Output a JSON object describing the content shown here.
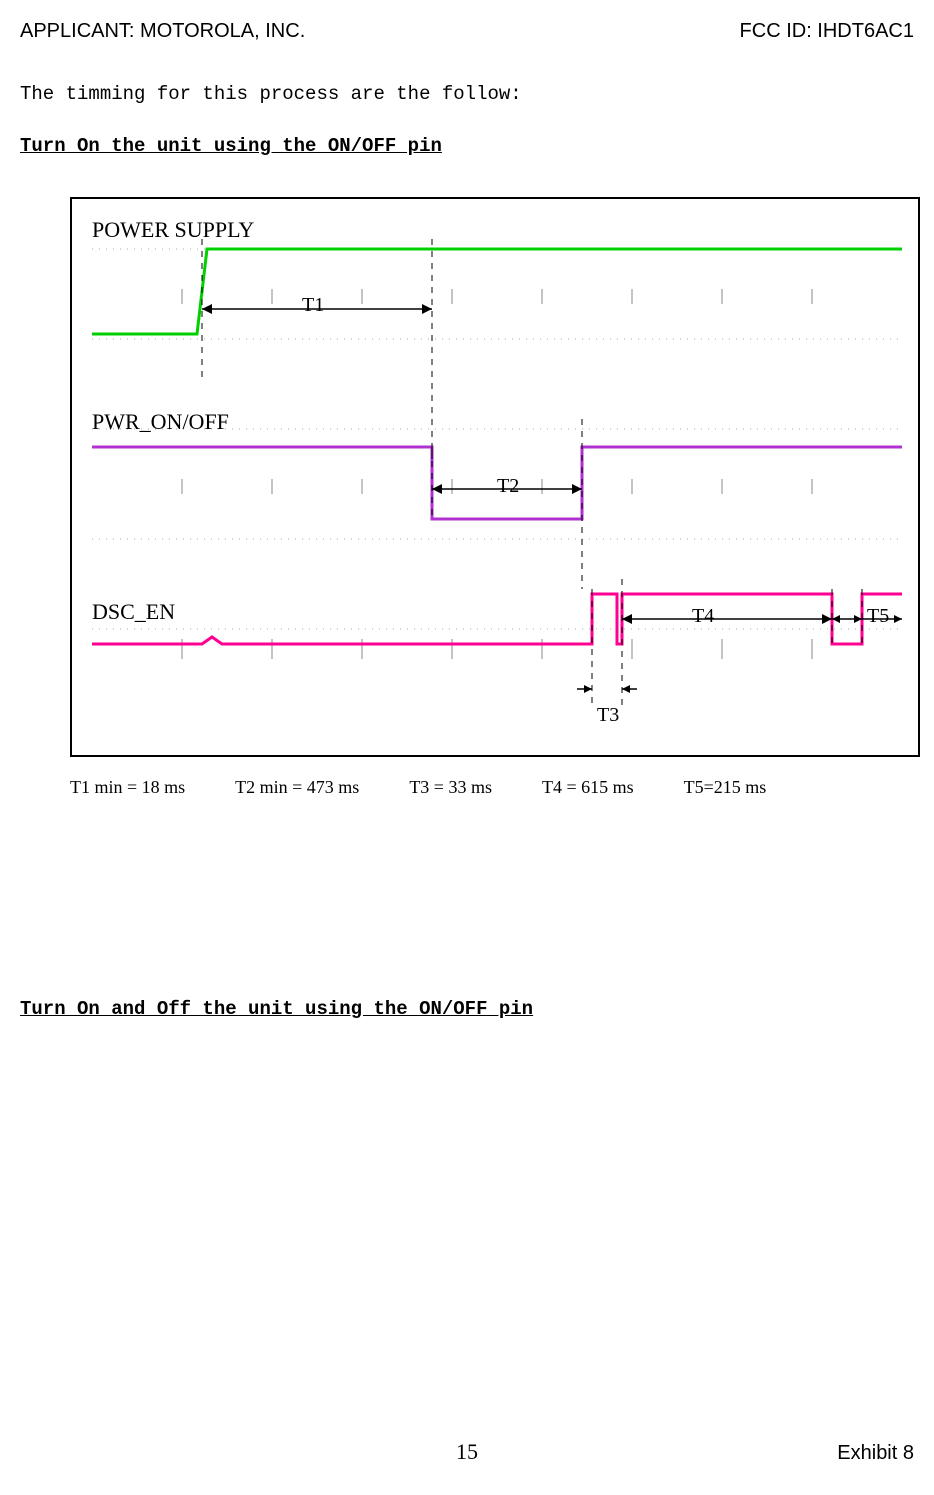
{
  "header": {
    "applicant": "APPLICANT:  MOTOROLA, INC.",
    "fccid": "FCC ID: IHDT6AC1"
  },
  "intro": "The timming for this process are the follow:",
  "section1": "Turn On the unit using the ON/OFF pin",
  "waveforms": {
    "label1": "POWER SUPPLY",
    "label2": "PWR_ON/OFF",
    "label3": "DSC_EN"
  },
  "tlabels": {
    "t1": "T1",
    "t2": "T2",
    "t3": "T3",
    "t4": "T4",
    "t5": "T5"
  },
  "timing": {
    "t1": "T1 min = 18 ms",
    "t2": "T2 min = 473 ms",
    "t3": "T3 = 33 ms",
    "t4": "T4 = 615 ms",
    "t5": "T5=215 ms"
  },
  "section2": "Turn On and Off the unit using the ON/OFF pin",
  "footer": {
    "page": "15",
    "exhibit": "Exhibit 8"
  }
}
